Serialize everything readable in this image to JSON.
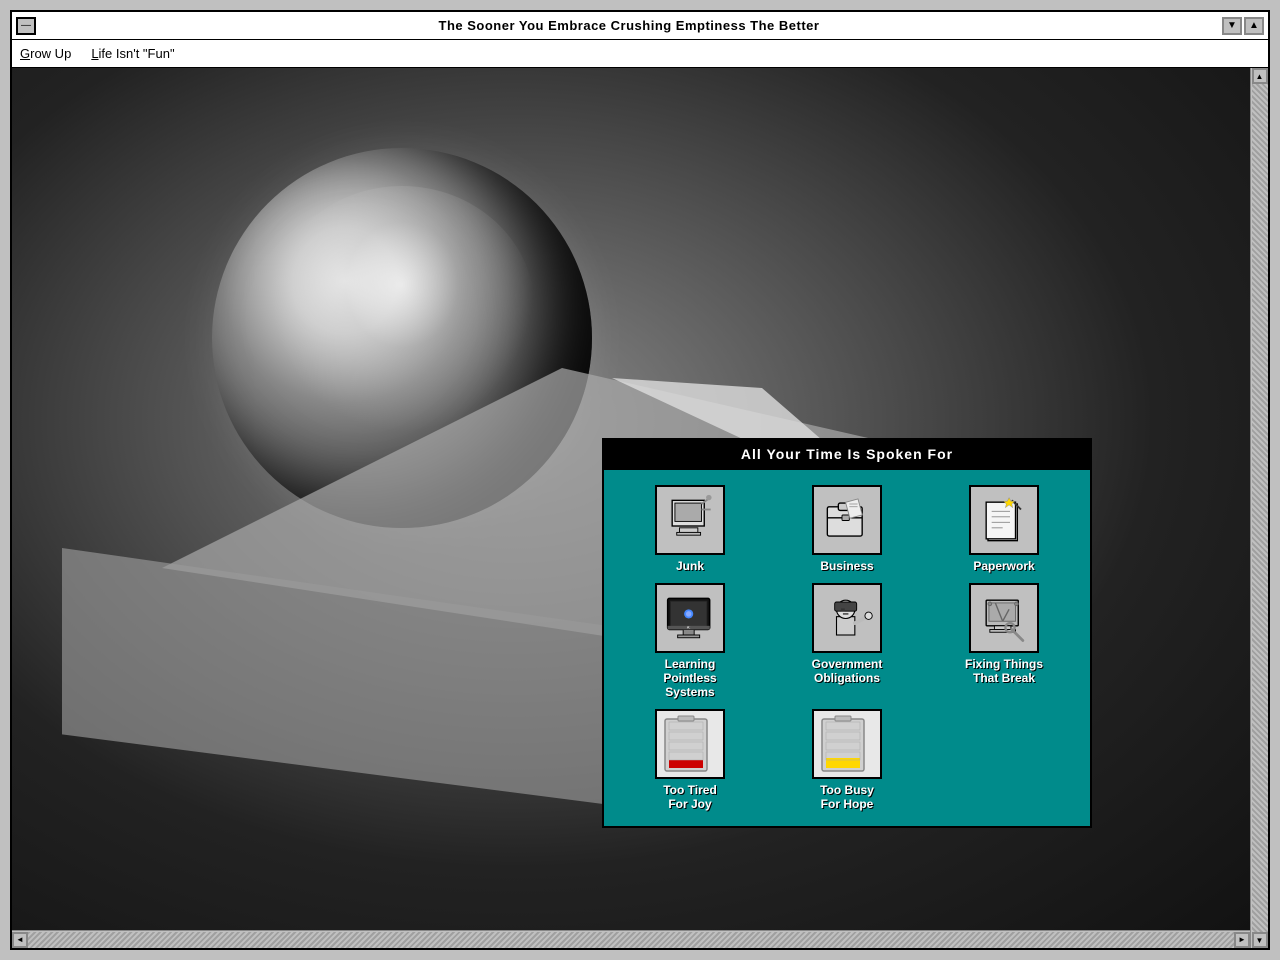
{
  "window": {
    "title": "The Sooner You Embrace Crushing Emptiness The Better",
    "close_btn": "—",
    "scroll_down": "▼",
    "scroll_up": "▲",
    "scroll_left": "◄",
    "scroll_right": "►"
  },
  "menubar": {
    "items": [
      {
        "label": "Grow Up",
        "underline_char": "G"
      },
      {
        "label": "Life Isn't \"Fun\"",
        "underline_char": "L"
      }
    ]
  },
  "dialog": {
    "title": "All Your Time Is Spoken For",
    "items": [
      {
        "id": "junk",
        "label": "Junk"
      },
      {
        "id": "business",
        "label": "Business"
      },
      {
        "id": "paperwork",
        "label": "Paperwork"
      },
      {
        "id": "learning",
        "label": "Learning\nPointless\nSystems"
      },
      {
        "id": "government",
        "label": "Government\nObligations"
      },
      {
        "id": "fixing",
        "label": "Fixing Things\nThat Break"
      },
      {
        "id": "too-tired",
        "label": "Too Tired\nFor Joy"
      },
      {
        "id": "too-busy",
        "label": "Too Busy\nFor Hope"
      }
    ]
  },
  "colors": {
    "teal": "#008B8B",
    "black": "#000000",
    "white": "#ffffff",
    "gray": "#c0c0c0"
  }
}
